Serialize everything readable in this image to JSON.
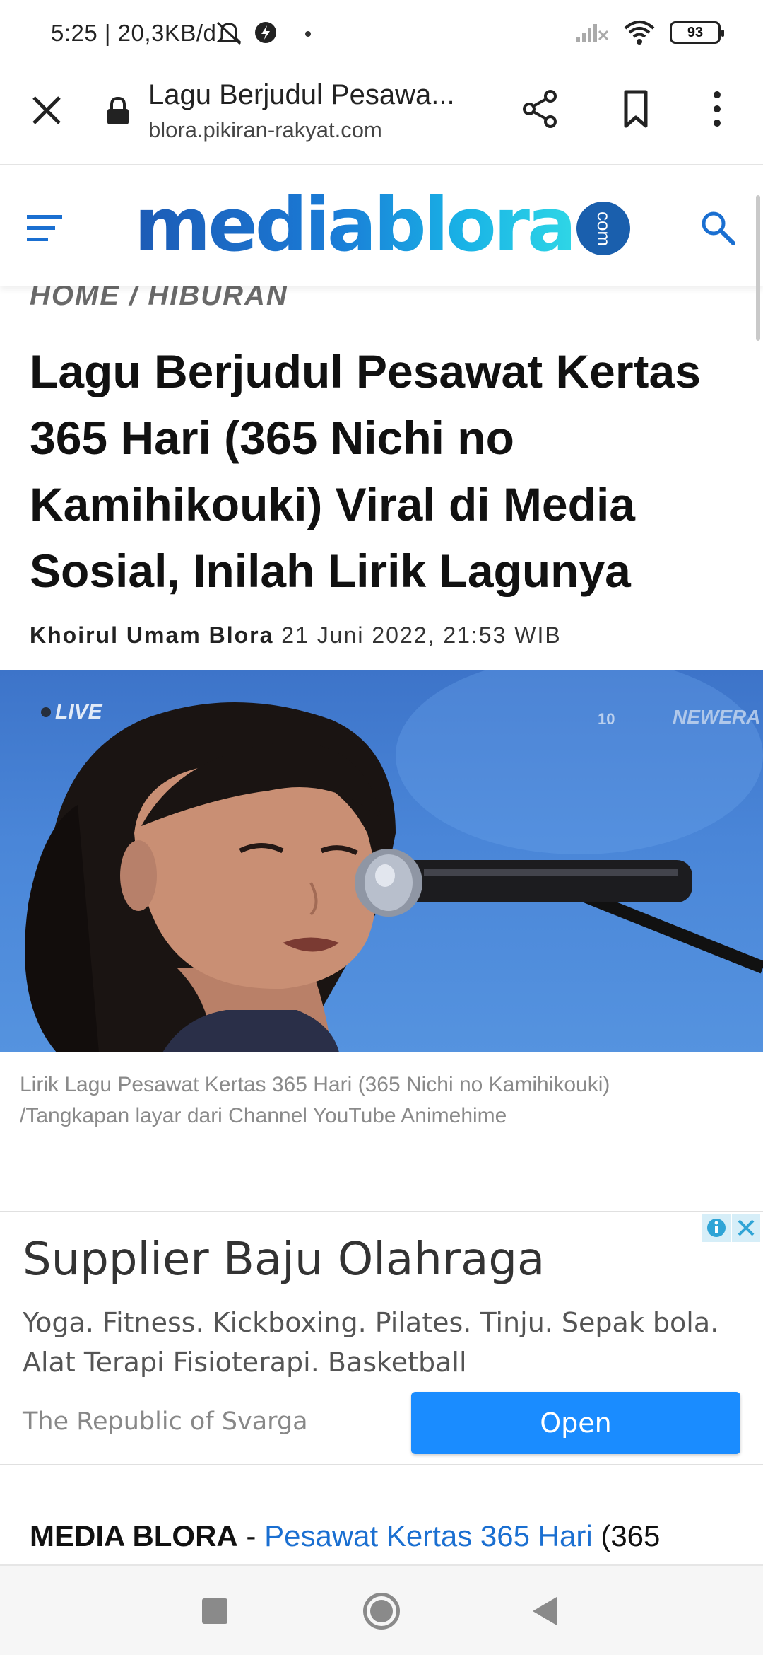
{
  "status_bar": {
    "time_speed": "5:25 | 20,3KB/d",
    "battery": "93",
    "icons": [
      "mute-icon",
      "data-saver-icon",
      "signal-icon",
      "wifi-icon",
      "battery-icon"
    ]
  },
  "browser": {
    "page_title": "Lagu Berjudul Pesawa...",
    "domain": "blora.pikiran-rakyat.com",
    "actions": [
      "close",
      "share",
      "bookmark",
      "more"
    ]
  },
  "site": {
    "logo_text": "mediablora",
    "logo_suffix": "com",
    "colors": {
      "brand_dark": "#1d5bb5",
      "brand_light": "#2fd6e6",
      "link": "#1a6fd1"
    }
  },
  "article": {
    "breadcrumb": "HOME / HIBURAN",
    "headline": "Lagu Berjudul Pesawat Kertas 365 Hari (365 Nichi no Kamihikouki) Viral di Media Sosial, Inilah Lirik Lagunya",
    "author": "Khoirul Umam Blora",
    "date": "21 Juni 2022, 21:53 WIB",
    "image": {
      "live_label": "LIVE",
      "watermark_ten": "10",
      "watermark_era": "NEWERA"
    },
    "caption_line1": "Lirik Lagu Pesawat Kertas 365 Hari (365 Nichi no Kamihikouki)",
    "caption_line2": "/Tangkapan layar dari Channel YouTube Animehime",
    "body_lead": "MEDIA BLORA",
    "body_sep": " - ",
    "body_link": "Pesawat Kertas 365 Hari",
    "body_rest": " (365"
  },
  "ad": {
    "title": "Supplier Baju Olahraga",
    "description": "Yoga. Fitness. Kickboxing. Pilates. Tinju. Sepak bola. Alat Terapi Fisioterapi. Basketball",
    "advertiser": "The Republic of Svarga",
    "cta": "Open",
    "cta_color": "#1a8cff"
  }
}
